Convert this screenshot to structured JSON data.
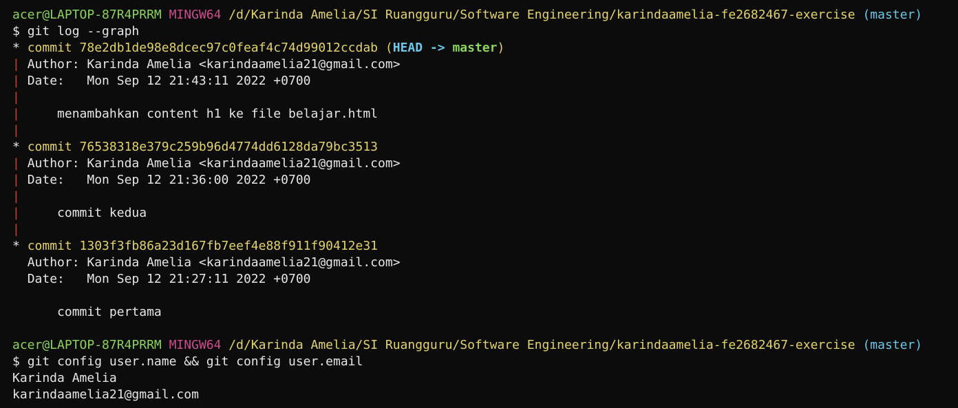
{
  "prompt": {
    "user_host": "acer@LAPTOP-87R4PRRM",
    "shell": "MINGW64",
    "path": "/d/Karinda Amelia/SI Ruangguru/Software Engineering/karindaamelia-fe2682467-exercise",
    "branch": "(master)",
    "symbol": "$"
  },
  "commands": {
    "log": "git log --graph",
    "config": "git config user.name && git config user.email"
  },
  "log": {
    "commits": [
      {
        "graph": "*",
        "hash_line": "commit 78e2db1de98e8dcec97c0feaf4c74d99012ccdab",
        "ref_open": "(",
        "head": "HEAD",
        "arrow": "->",
        "branch": "master",
        "ref_close": ")",
        "author": "Author: Karinda Amelia <karindaamelia21@gmail.com>",
        "date": "Date:   Mon Sep 12 21:43:11 2022 +0700",
        "message": "menambahkan content h1 ke file belajar.html"
      },
      {
        "graph": "*",
        "hash_line": "commit 76538318e379c259b96d4774dd6128da79bc3513",
        "author": "Author: Karinda Amelia <karindaamelia21@gmail.com>",
        "date": "Date:   Mon Sep 12 21:36:00 2022 +0700",
        "message": "commit kedua"
      },
      {
        "graph": "*",
        "hash_line": "commit 1303f3fb86a23d167fb7eef4e88f911f90412e31",
        "author": "Author: Karinda Amelia <karindaamelia21@gmail.com>",
        "date": "Date:   Mon Sep 12 21:27:11 2022 +0700",
        "message": "commit pertama"
      }
    ],
    "graph_pipe": "|"
  },
  "output": {
    "user_name": "Karinda Amelia",
    "user_email": "karindaamelia21@gmail.com"
  },
  "colors": {
    "background": "#0c0c0c",
    "text": "#e6e6e6",
    "user_host": "#8bd35d",
    "shell": "#d04a8f",
    "path": "#e2d36a",
    "branch": "#6cc7e8",
    "graph_pipe": "#d43a3a"
  }
}
